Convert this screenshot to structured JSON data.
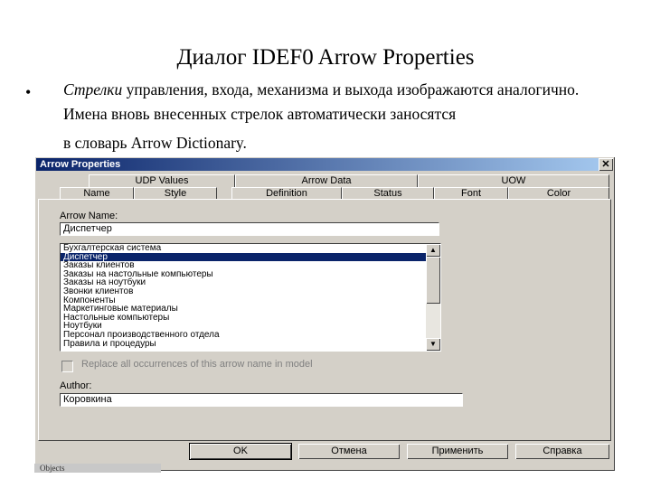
{
  "slide": {
    "title": "Диалог IDEF0 Arrow Properties",
    "bullet": "•",
    "text_italic": "Стрелки",
    "text_line1": " управления, входа, механизма и выхода изображаются аналогично. Имена вновь внесенных стрелок автоматически заносятся",
    "text_line3": "в словарь Arrow Dictionary."
  },
  "dialog": {
    "title": "Arrow Properties",
    "close": "✕",
    "tabs_back": [
      "UDP Values",
      "Arrow Data",
      "UOW"
    ],
    "tabs_front": [
      "Name",
      "Style",
      "Definition",
      "Status",
      "Font",
      "Color"
    ],
    "arrow_name_label": "Arrow Name:",
    "arrow_name_value": "Диспетчер",
    "list_items": [
      "Бухгалтерская система",
      "Диспетчер",
      "Заказы клиентов",
      "Заказы на настольные компьютеры",
      "Заказы на ноутбуки",
      "Звонки клиентов",
      "Компоненты",
      "Маркетинговые материалы",
      "Настольные компьютеры",
      "Ноутбуки",
      "Персонал производственного отдела",
      "Правила и процедуры"
    ],
    "selected_index": 1,
    "replace_label": "Replace all occurrences of this arrow name in model",
    "author_label": "Author:",
    "author_value": "Коровкина",
    "buttons": {
      "ok": "OK",
      "cancel": "Отмена",
      "apply": "Применить",
      "help": "Справка"
    },
    "scroll_up": "▲",
    "scroll_down": "▼"
  },
  "background_strip": "Objects"
}
